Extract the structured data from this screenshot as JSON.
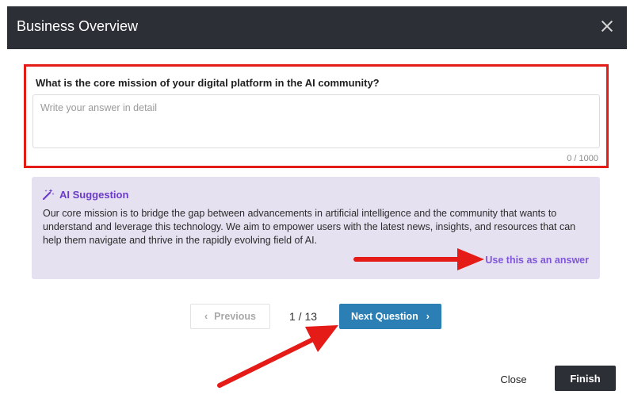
{
  "header": {
    "title": "Business Overview"
  },
  "question": {
    "label": "What is the core mission of your digital platform in the AI community?",
    "placeholder": "Write your answer in detail",
    "value": "",
    "char_count": "0 / 1000"
  },
  "suggestion": {
    "title": "AI Suggestion",
    "text": "Our core mission is to bridge the gap between advancements in artificial intelligence and the community that wants to understand and leverage this technology. We aim to empower users with the latest news, insights, and resources that can help them navigate and thrive in the rapidly evolving field of AI.",
    "use_label": "Use this as an answer"
  },
  "pagination": {
    "previous_label": "Previous",
    "page_indicator": "1 / 13",
    "next_label": "Next Question"
  },
  "footer": {
    "close_label": "Close",
    "finish_label": "Finish"
  },
  "colors": {
    "header_bg": "#2c2f36",
    "highlight_border": "#e41b17",
    "suggestion_bg": "#e5e1f0",
    "suggestion_accent": "#6a3cc8",
    "primary_button": "#2b7fb5",
    "annotation_arrow": "#e41b17"
  }
}
